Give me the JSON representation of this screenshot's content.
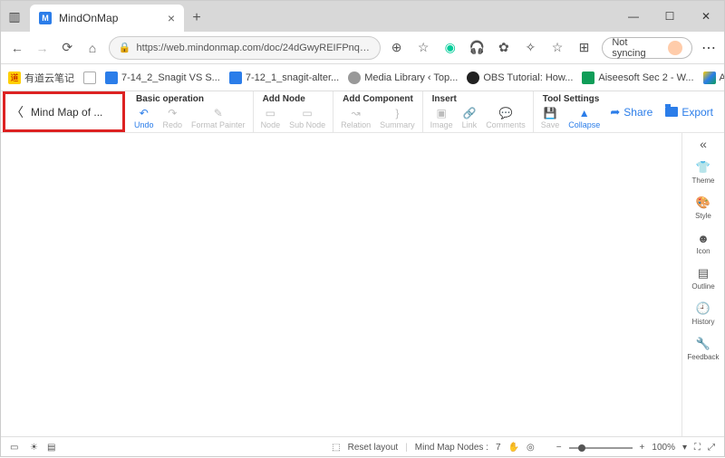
{
  "browser": {
    "tab_title": "MindOnMap",
    "url": "https://web.mindonmap.com/doc/24dGwyREIFPnqgF5LBSz...",
    "sync_label": "Not syncing"
  },
  "bookmarks": [
    {
      "label": "有道云笔记"
    },
    {
      "label": "7-14_2_Snagit VS S..."
    },
    {
      "label": "7-12_1_snagit-alter..."
    },
    {
      "label": "Media Library ‹ Top..."
    },
    {
      "label": "OBS Tutorial: How..."
    },
    {
      "label": "Aiseesoft Sec 2 - W..."
    },
    {
      "label": "Article-Drafts - Goo..."
    }
  ],
  "doc_title": "Mind Map of ...",
  "toolbar": {
    "groups": {
      "basic": {
        "label": "Basic operation",
        "items": [
          "Undo",
          "Redo",
          "Format Painter"
        ]
      },
      "addnode": {
        "label": "Add Node",
        "items": [
          "Node",
          "Sub Node"
        ]
      },
      "addcomp": {
        "label": "Add Component",
        "items": [
          "Relation",
          "Summary"
        ]
      },
      "insert": {
        "label": "Insert",
        "items": [
          "Image",
          "Link",
          "Comments"
        ]
      },
      "tools": {
        "label": "Tool Settings",
        "items": [
          "Save",
          "Collapse"
        ]
      }
    },
    "share": "Share",
    "export": "Export"
  },
  "sidepanel": {
    "items": [
      "Theme",
      "Style",
      "Icon",
      "Outline",
      "History",
      "Feedback"
    ]
  },
  "statusbar": {
    "reset": "Reset layout",
    "nodes_label": "Mind Map Nodes :",
    "nodes_count": "7",
    "zoom": "100%"
  }
}
